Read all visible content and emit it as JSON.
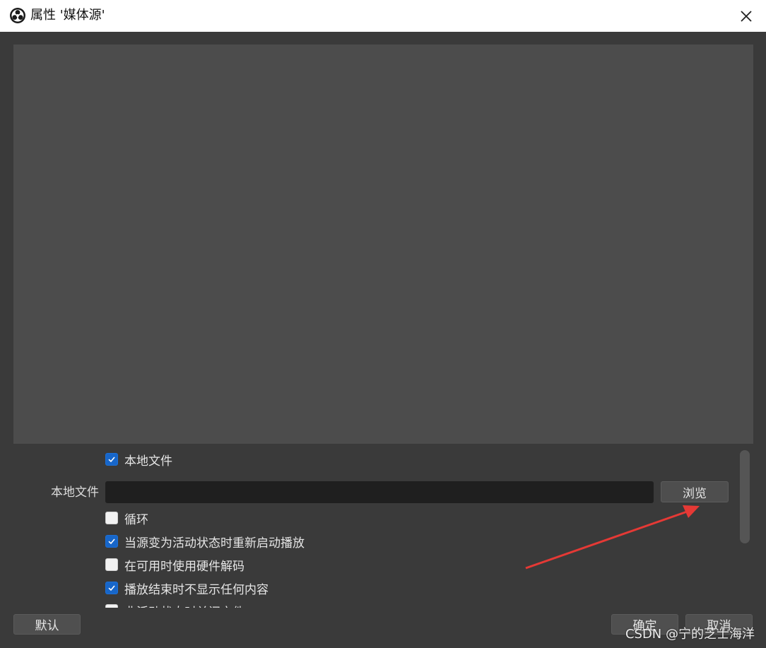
{
  "window": {
    "title": "属性 '媒体源'"
  },
  "properties": {
    "local_file_checkbox": {
      "label": "本地文件",
      "checked": true
    },
    "local_file_field": {
      "label": "本地文件",
      "value": "",
      "browse_label": "浏览"
    },
    "loop_checkbox": {
      "label": "循环",
      "checked": false
    },
    "restart_checkbox": {
      "label": "当源变为活动状态时重新启动播放",
      "checked": true
    },
    "hw_decode_checkbox": {
      "label": "在可用时使用硬件解码",
      "checked": false
    },
    "hide_on_end_checkbox": {
      "label": "播放结束时不显示任何内容",
      "checked": true
    },
    "partial_checkbox": {
      "label": "非活动状态时关闭文件",
      "checked": false
    }
  },
  "footer": {
    "defaults_label": "默认",
    "ok_label": "确定",
    "cancel_label": "取消"
  },
  "watermark": "CSDN @宁的芝士海洋",
  "colors": {
    "checkbox_on": "#1766c9",
    "annotation_arrow": "#e53935"
  }
}
